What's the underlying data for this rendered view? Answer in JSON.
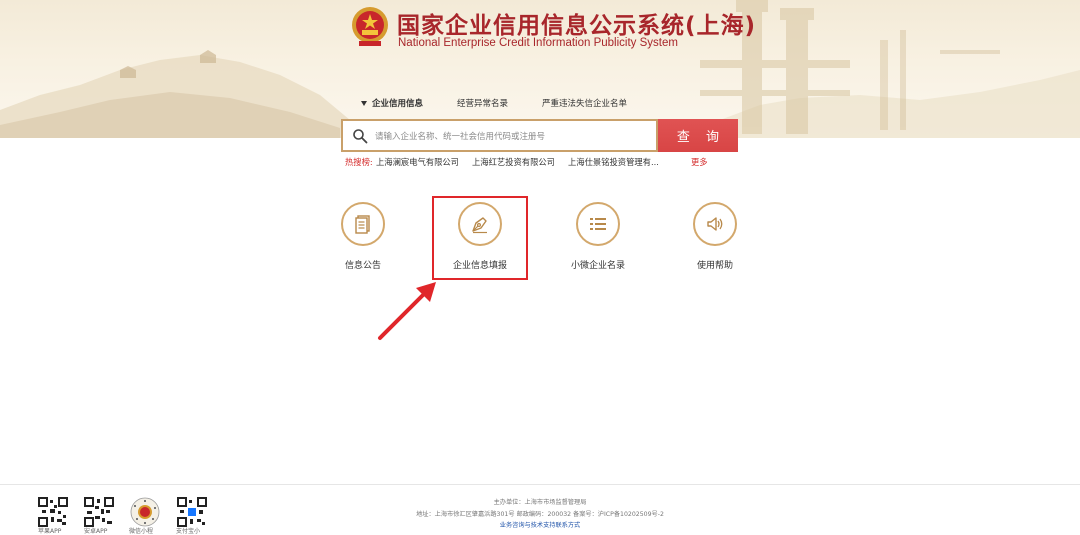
{
  "header": {
    "title_cn": "国家企业信用信息公示系统(上海)",
    "title_en": "National Enterprise Credit Information Publicity System",
    "emblem_icon": "national-emblem-icon"
  },
  "tabs": [
    {
      "label": "企业信用信息",
      "active": true
    },
    {
      "label": "经营异常名录",
      "active": false
    },
    {
      "label": "严重违法失信企业名单",
      "active": false
    }
  ],
  "search": {
    "placeholder": "请输入企业名称、统一社会信用代码或注册号",
    "value": "",
    "button_label": "查 询"
  },
  "hot": {
    "label": "热搜榜:",
    "items": [
      "上海澜宸电气有限公司",
      "上海红艺投资有限公司",
      "上海仕景铭投资管理有..."
    ],
    "more": "更多"
  },
  "quick_links": [
    {
      "label": "信息公告",
      "icon": "document-icon"
    },
    {
      "label": "企业信息填报",
      "icon": "pen-nib-icon"
    },
    {
      "label": "小微企业名录",
      "icon": "list-icon"
    },
    {
      "label": "使用帮助",
      "icon": "speaker-icon"
    }
  ],
  "colors": {
    "brand_red": "#a8262b",
    "button_red": "#d84545",
    "gold": "#d3a86c",
    "highlight": "#e0262a"
  },
  "footer": {
    "apps": [
      {
        "label": "苹果APP",
        "icon": "qr-code-icon"
      },
      {
        "label": "安卓APP",
        "icon": "qr-code-icon"
      },
      {
        "label": "微信小程",
        "icon": "emblem-qr-icon"
      },
      {
        "label": "支付宝小",
        "icon": "qr-code-icon"
      }
    ],
    "sponsor": "主办单位：上海市市场监督管理局",
    "address": "地址：上海市徐汇区肇嘉浜路301号  邮政编码：200032  备案号：沪ICP备10202509号-2",
    "contact": "业务咨询与技术支持联系方式"
  }
}
